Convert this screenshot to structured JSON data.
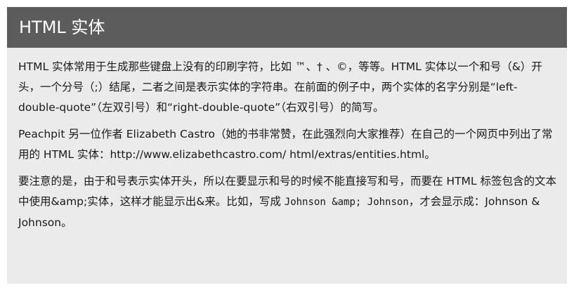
{
  "header": {
    "title": "HTML 实体"
  },
  "paragraphs": {
    "p1": "HTML 实体常用于生成那些键盘上没有的印刷字符，比如 ™、† 、©，等等。HTML 实体以一个和号（&）开头，一个分号（;）结尾，二者之间是表示实体的字符串。在前面的例子中，两个实体的名字分别是“left-double-quote”（左双引号）和“right-double-quote”（右双引号）的简写。",
    "p2": "Peachpit 另一位作者 Elizabeth Castro（她的书非常赞，在此强烈向大家推荐）在自己的一个网页中列出了常用的 HTML 实体：http://www.elizabethcastro.com/ html/extras/entities.html。",
    "p3": {
      "part1": "要注意的是，由于和号表示实体开头，所以在要显示和号的时候不能直接写和号，而要在 HTML 标签包含的文本中使用&amp;实体，这样才能显示出&来。比如，写成 ",
      "code": "Johnson &amp; Johnson",
      "part2": "，才会显示成：Johnson & Johnson。"
    }
  }
}
